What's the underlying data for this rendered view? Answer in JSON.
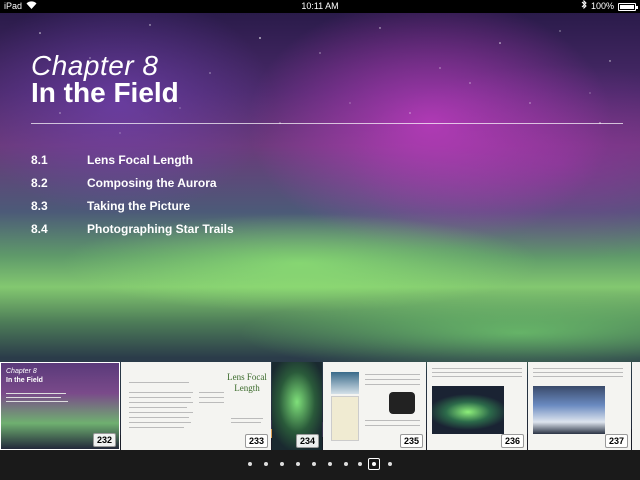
{
  "status": {
    "device": "iPad",
    "time": "10:11 AM",
    "battery": "100%",
    "battery_level": 1.0
  },
  "chapter": {
    "number": "Chapter 8",
    "title": "In the Field"
  },
  "toc": [
    {
      "num": "8.1",
      "label": "Lens Focal Length"
    },
    {
      "num": "8.2",
      "label": "Composing the Aurora"
    },
    {
      "num": "8.3",
      "label": "Taking the Picture"
    },
    {
      "num": "8.4",
      "label": "Photographing Star Trails"
    }
  ],
  "thumbnails": [
    {
      "page": "232",
      "chapter_label": "Chapter 8",
      "title_label": "In the Field"
    },
    {
      "page": "233",
      "heading": "Lens Focal Length"
    },
    {
      "page": "234"
    },
    {
      "page": "235"
    },
    {
      "page": "236"
    },
    {
      "page": "237"
    }
  ],
  "pager": {
    "dot_count": 10,
    "active_index": 8
  },
  "icons": {
    "wifi": "wifi-icon",
    "bluetooth": "bluetooth-icon",
    "battery": "battery-icon"
  }
}
